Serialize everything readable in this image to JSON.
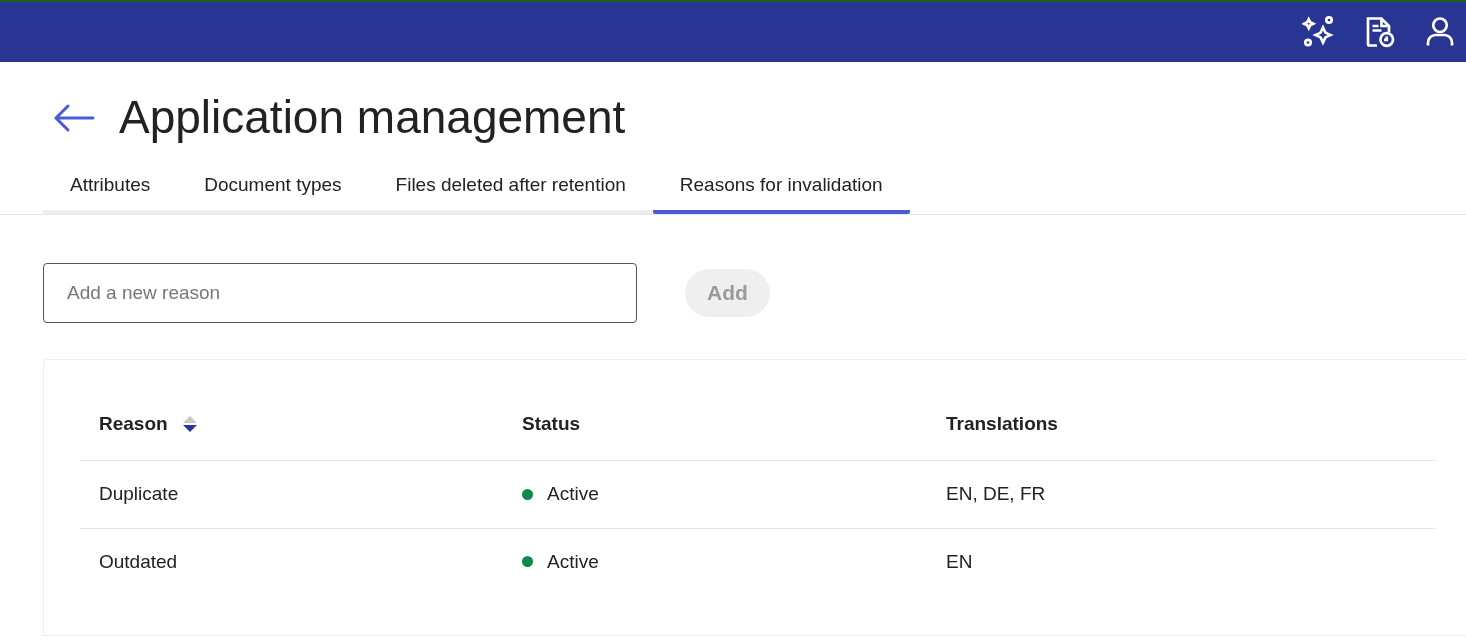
{
  "page": {
    "title": "Application management"
  },
  "tabs": [
    {
      "label": "Attributes",
      "selected": false
    },
    {
      "label": "Document types",
      "selected": false
    },
    {
      "label": "Files deleted after retention",
      "selected": false
    },
    {
      "label": "Reasons for invalidation",
      "selected": true
    }
  ],
  "new_reason": {
    "placeholder": "Add a new reason",
    "button": "Add",
    "disabled": true
  },
  "table": {
    "columns": [
      {
        "label": "Reason",
        "sorted": true
      },
      {
        "label": "Status",
        "sorted": false
      },
      {
        "label": "Translations",
        "sorted": false
      }
    ],
    "rows": [
      {
        "reason": "Duplicate",
        "status": "Active",
        "color": "#0b8a4a",
        "translations": "EN, DE, FR"
      },
      {
        "reason": "Outdated",
        "status": "Active",
        "color": "#0b8a4a",
        "translations": "EN"
      }
    ]
  }
}
